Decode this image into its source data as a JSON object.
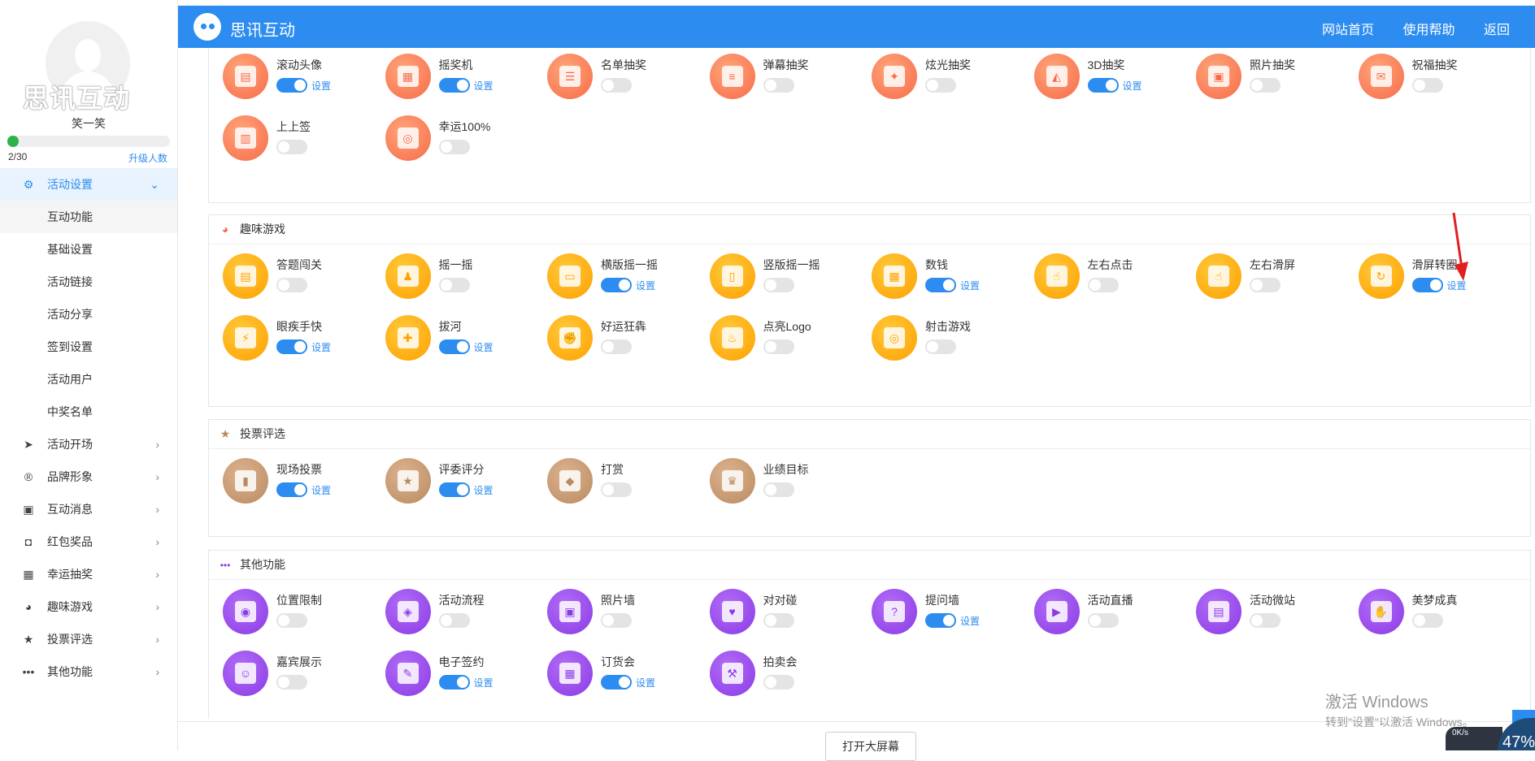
{
  "header": {
    "app_title": "思讯互动",
    "nav": [
      "网站首页",
      "使用帮助",
      "返回"
    ]
  },
  "profile": {
    "brand_watermark": "思讯互动",
    "username": "笑一笑",
    "progress_count": "2/30",
    "progress_fraction": 0.067,
    "upgrade_label": "升级人数"
  },
  "sidebar": {
    "items": [
      {
        "label": "活动设置",
        "icon": "gear-icon",
        "expanded": true
      },
      {
        "label": "互动功能"
      },
      {
        "label": "基础设置"
      },
      {
        "label": "活动链接"
      },
      {
        "label": "活动分享"
      },
      {
        "label": "签到设置"
      },
      {
        "label": "活动用户"
      },
      {
        "label": "中奖名单"
      },
      {
        "label": "活动开场",
        "icon": "paper-plane-icon"
      },
      {
        "label": "品牌形象",
        "icon": "registered-icon"
      },
      {
        "label": "互动消息",
        "icon": "chat-icon"
      },
      {
        "label": "红包奖品",
        "icon": "gift-icon"
      },
      {
        "label": "幸运抽奖",
        "icon": "lottery-icon"
      },
      {
        "label": "趣味游戏",
        "icon": "pacman-icon"
      },
      {
        "label": "投票评选",
        "icon": "star-icon"
      },
      {
        "label": "其他功能",
        "icon": "more-dots-icon"
      }
    ]
  },
  "sections": {
    "lottery": {
      "features": [
        {
          "name": "滚动头像",
          "on": true
        },
        {
          "name": "摇奖机",
          "on": true
        },
        {
          "name": "名单抽奖",
          "on": false
        },
        {
          "name": "弹幕抽奖",
          "on": false
        },
        {
          "name": "炫光抽奖",
          "on": false
        },
        {
          "name": "3D抽奖",
          "on": true
        },
        {
          "name": "照片抽奖",
          "on": false
        },
        {
          "name": "祝福抽奖",
          "on": false
        },
        {
          "name": "上上签",
          "on": false
        },
        {
          "name": "幸运100%",
          "on": false
        }
      ]
    },
    "games": {
      "title": "趣味游戏",
      "features": [
        {
          "name": "答题闯关",
          "on": false
        },
        {
          "name": "摇一摇",
          "on": false
        },
        {
          "name": "横版摇一摇",
          "on": true
        },
        {
          "name": "竖版摇一摇",
          "on": false
        },
        {
          "name": "数钱",
          "on": true
        },
        {
          "name": "左右点击",
          "on": false
        },
        {
          "name": "左右滑屏",
          "on": false
        },
        {
          "name": "滑屏转圈",
          "on": true
        },
        {
          "name": "眼疾手快",
          "on": true
        },
        {
          "name": "拔河",
          "on": true
        },
        {
          "name": "好运狂犇",
          "on": false
        },
        {
          "name": "点亮Logo",
          "on": false
        },
        {
          "name": "射击游戏",
          "on": false
        }
      ]
    },
    "vote": {
      "title": "投票评选",
      "features": [
        {
          "name": "现场投票",
          "on": true
        },
        {
          "name": "评委评分",
          "on": true
        },
        {
          "name": "打赏",
          "on": false
        },
        {
          "name": "业绩目标",
          "on": false
        }
      ]
    },
    "other": {
      "title": "其他功能",
      "features": [
        {
          "name": "位置限制",
          "on": false
        },
        {
          "name": "活动流程",
          "on": false
        },
        {
          "name": "照片墙",
          "on": false
        },
        {
          "name": "对对碰",
          "on": false
        },
        {
          "name": "提问墙",
          "on": true
        },
        {
          "name": "活动直播",
          "on": false
        },
        {
          "name": "活动微站",
          "on": false
        },
        {
          "name": "美梦成真",
          "on": false
        },
        {
          "name": "嘉宾展示",
          "on": false
        },
        {
          "name": "电子签约",
          "on": true
        },
        {
          "name": "订货会",
          "on": true
        },
        {
          "name": "拍卖会",
          "on": false
        }
      ]
    }
  },
  "settings_label": "设置",
  "bottom": {
    "open_screen_label": "打开大屏幕"
  },
  "watermark": {
    "line1": "激活 Windows",
    "line2": "转到\"设置\"以激活 Windows。"
  },
  "net_widget": {
    "speed": "0K/s",
    "percent": "47%"
  },
  "colors": {
    "accent": "#2d8cf0",
    "orange": "#f76b49",
    "yellow": "#ffa000",
    "brown": "#b98a61",
    "purple": "#8a3be6",
    "progress": "#2eb24a"
  }
}
